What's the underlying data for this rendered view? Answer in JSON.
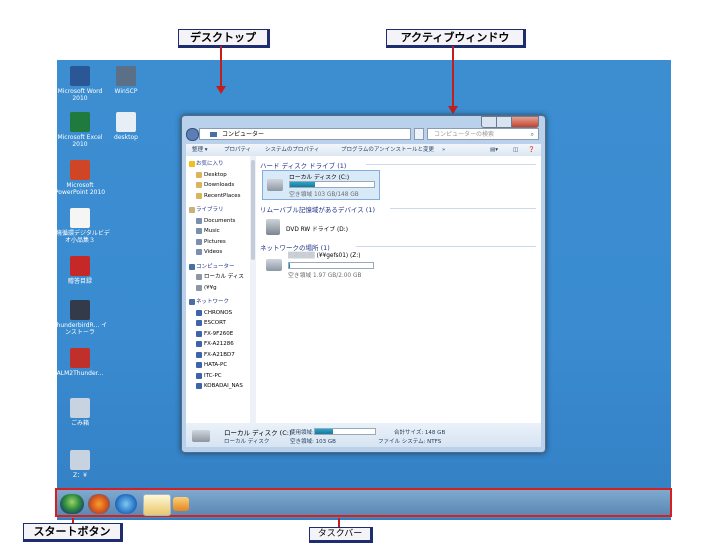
{
  "callouts": {
    "desktop": "デスクトップ",
    "active_window": "アクティブウィンドウ",
    "start_button": "スタートボタン",
    "taskbar": "タスクバー"
  },
  "desktop_icons": [
    {
      "label": "Microsoft Word 2010",
      "icon": "word-icon",
      "color": "#2b5797"
    },
    {
      "label": "WinSCP",
      "icon": "winscp-icon",
      "color": "#5b6f86"
    },
    {
      "label": "Microsoft Excel 2010",
      "icon": "excel-icon",
      "color": "#1f7a3e"
    },
    {
      "label": "desktop",
      "icon": "desktop-file-icon",
      "color": "#e8eef5"
    },
    {
      "label": "Microsoft PowerPoint 2010",
      "icon": "powerpoint-icon",
      "color": "#d04525"
    },
    {
      "label": "環境循環デジタルビデオ小品集３",
      "icon": "fime-icon",
      "color": "#f5f5f5"
    },
    {
      "label": "贈答目録",
      "icon": "pdf-icon",
      "color": "#c62828"
    },
    {
      "label": "ThunderbirdR... インストーラ",
      "icon": "thunderbird-installer-icon",
      "color": "#333b4a"
    },
    {
      "label": "ALM2Thunder...",
      "icon": "alm2thunder-icon",
      "color": "#c0302a"
    },
    {
      "label": "ごみ箱",
      "icon": "recycle-bin-icon",
      "color": "#c7d3e0"
    },
    {
      "label": "Z：¥",
      "icon": "network-drive-icon",
      "color": "#c7d3e0"
    }
  ],
  "window": {
    "address": "コンピューター",
    "search_placeholder": "コンピューターの検索",
    "toolbar": [
      "整理 ▾",
      "プロパティ",
      "システムのプロパティ",
      "プログラムのアンインストールと変更",
      "»"
    ],
    "nav": {
      "favorites": "お気に入り",
      "favorites_items": [
        "Desktop",
        "Downloads",
        "RecentPlaces"
      ],
      "libraries": "ライブラリ",
      "library_items": [
        "Documents",
        "Music",
        "Pictures",
        "Videos"
      ],
      "computer": "コンピューター",
      "computer_items": [
        "ローカル ディス",
        "(¥¥g"
      ],
      "network": "ネットワーク",
      "network_items": [
        "CHRONOS",
        "ESCORT",
        "FX-9F260E",
        "FX-A21286",
        "FX-A21BD7",
        "HATA-PC",
        "ITC-PC",
        "KOBADAI_NAS"
      ]
    },
    "hdd_section": "ハード ディスク ドライブ (1)",
    "local_disk_name": "ローカル ディスク (C:)",
    "local_disk_free": "空き領域 103 GB/148 GB",
    "local_disk_used_fraction": 0.3,
    "removable_section": "リムーバブル記憶域があるデバイス (1)",
    "dvd_name": "DVD RW ドライブ (D:)",
    "network_section": "ネットワークの場所 (1)",
    "net_drive_name": "(¥¥gefs01) (Z:)",
    "net_drive_free": "空き領域 1.97 GB/2.00 GB",
    "net_drive_used_fraction": 0.015,
    "details": {
      "title": "ローカル ディスク (C:)",
      "subtitle": "ローカル ディスク",
      "used_label": "使用領域:",
      "free_label": "空き領域: 103 GB",
      "total_label": "合計サイズ: 148 GB",
      "fs_label": "ファイル システム: NTFS"
    }
  },
  "taskbar_items": [
    "start-orb-icon",
    "firefox-icon",
    "internet-explorer-icon",
    "explorer-folder-icon",
    "media-player-icon"
  ]
}
